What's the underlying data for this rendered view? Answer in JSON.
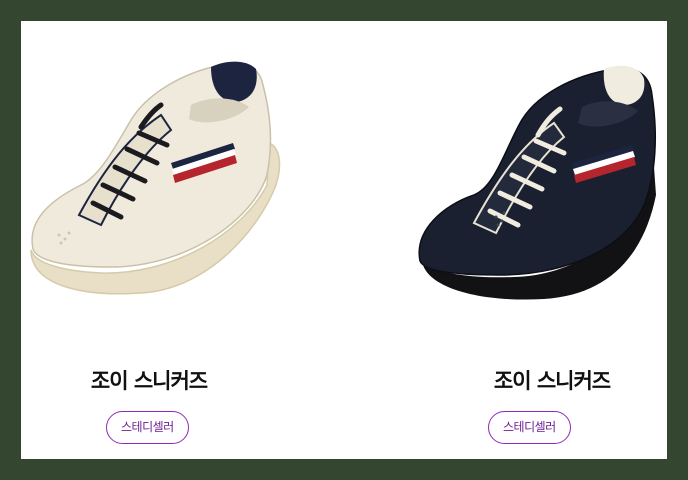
{
  "products": [
    {
      "name": "조이 스니커즈",
      "brand_label": "스테디셀러",
      "image_alt": "cream leather sneaker with navy laces",
      "colors": {
        "upper": "#efeadb",
        "lace": "#1a1a1f",
        "sole": "#e8dfc6",
        "stripe_red": "#b5252e",
        "stripe_navy": "#1c2440"
      }
    },
    {
      "name": "조이 스니커즈",
      "brand_label": "스테디셀러",
      "image_alt": "navy leather sneaker with cream laces",
      "colors": {
        "upper": "#1b2030",
        "lace": "#f1ece0",
        "sole": "#121215",
        "stripe_red": "#b5252e",
        "stripe_navy": "#1c2440"
      }
    }
  ],
  "theme": {
    "frame": "#344530",
    "accent": "#8e2bb4"
  }
}
